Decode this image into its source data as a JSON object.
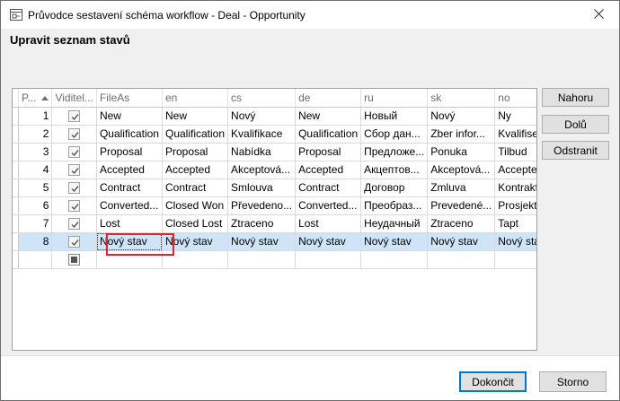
{
  "window": {
    "title": "Průvodce sestavení schéma workflow - Deal - Opportunity",
    "close_glyph": "✕"
  },
  "header": {
    "title": "Upravit seznam stavů"
  },
  "grid": {
    "columns": [
      "P...",
      "Viditel...",
      "FileAs",
      "en",
      "cs",
      "de",
      "ru",
      "sk",
      "no"
    ],
    "rows": [
      {
        "pos": "1",
        "visible": true,
        "fileas": "New",
        "en": "New",
        "cs": "Nový",
        "de": "New",
        "ru": "Новый",
        "sk": "Nový",
        "no": "Ny"
      },
      {
        "pos": "2",
        "visible": true,
        "fileas": "Qualification",
        "en": "Qualification",
        "cs": "Kvalifikace",
        "de": "Qualification",
        "ru": "Сбор дан...",
        "sk": "Zber infor...",
        "no": "Kvalifisering"
      },
      {
        "pos": "3",
        "visible": true,
        "fileas": "Proposal",
        "en": "Proposal",
        "cs": "Nabídka",
        "de": "Proposal",
        "ru": "Предложе...",
        "sk": "Ponuka",
        "no": "Tilbud"
      },
      {
        "pos": "4",
        "visible": true,
        "fileas": "Accepted",
        "en": "Accepted",
        "cs": "Akceptová...",
        "de": "Accepted",
        "ru": "Акцептов...",
        "sk": "Akceptová...",
        "no": "Accepted"
      },
      {
        "pos": "5",
        "visible": true,
        "fileas": "Contract",
        "en": "Contract",
        "cs": "Smlouva",
        "de": "Contract",
        "ru": "Договор",
        "sk": "Zmluva",
        "no": "Kontrakt"
      },
      {
        "pos": "6",
        "visible": true,
        "fileas": "Converted...",
        "en": "Closed Won",
        "cs": "Převedeno...",
        "de": "Converted...",
        "ru": "Преобраз...",
        "sk": "Prevedené...",
        "no": "Prosjekt"
      },
      {
        "pos": "7",
        "visible": true,
        "fileas": "Lost",
        "en": "Closed Lost",
        "cs": "Ztraceno",
        "de": "Lost",
        "ru": "Неудачный",
        "sk": "Ztraceno",
        "no": "Tapt"
      },
      {
        "pos": "8",
        "visible": true,
        "fileas": "Nový stav",
        "en": "Nový stav",
        "cs": "Nový stav",
        "de": "Nový stav",
        "ru": "Nový stav",
        "sk": "Nový stav",
        "no": "Nový stav"
      }
    ],
    "new_row_glyph": "✱",
    "current_row_glyph": "▸"
  },
  "side_buttons": {
    "up": "Nahoru",
    "down": "Dolů",
    "remove": "Odstranit"
  },
  "footer": {
    "ok": "Dokončit",
    "cancel": "Storno"
  },
  "colors": {
    "selection": "#cfe4f7",
    "highlight": "#e0222b",
    "accent": "#0078d7",
    "new_row_star": "#f0a000"
  }
}
